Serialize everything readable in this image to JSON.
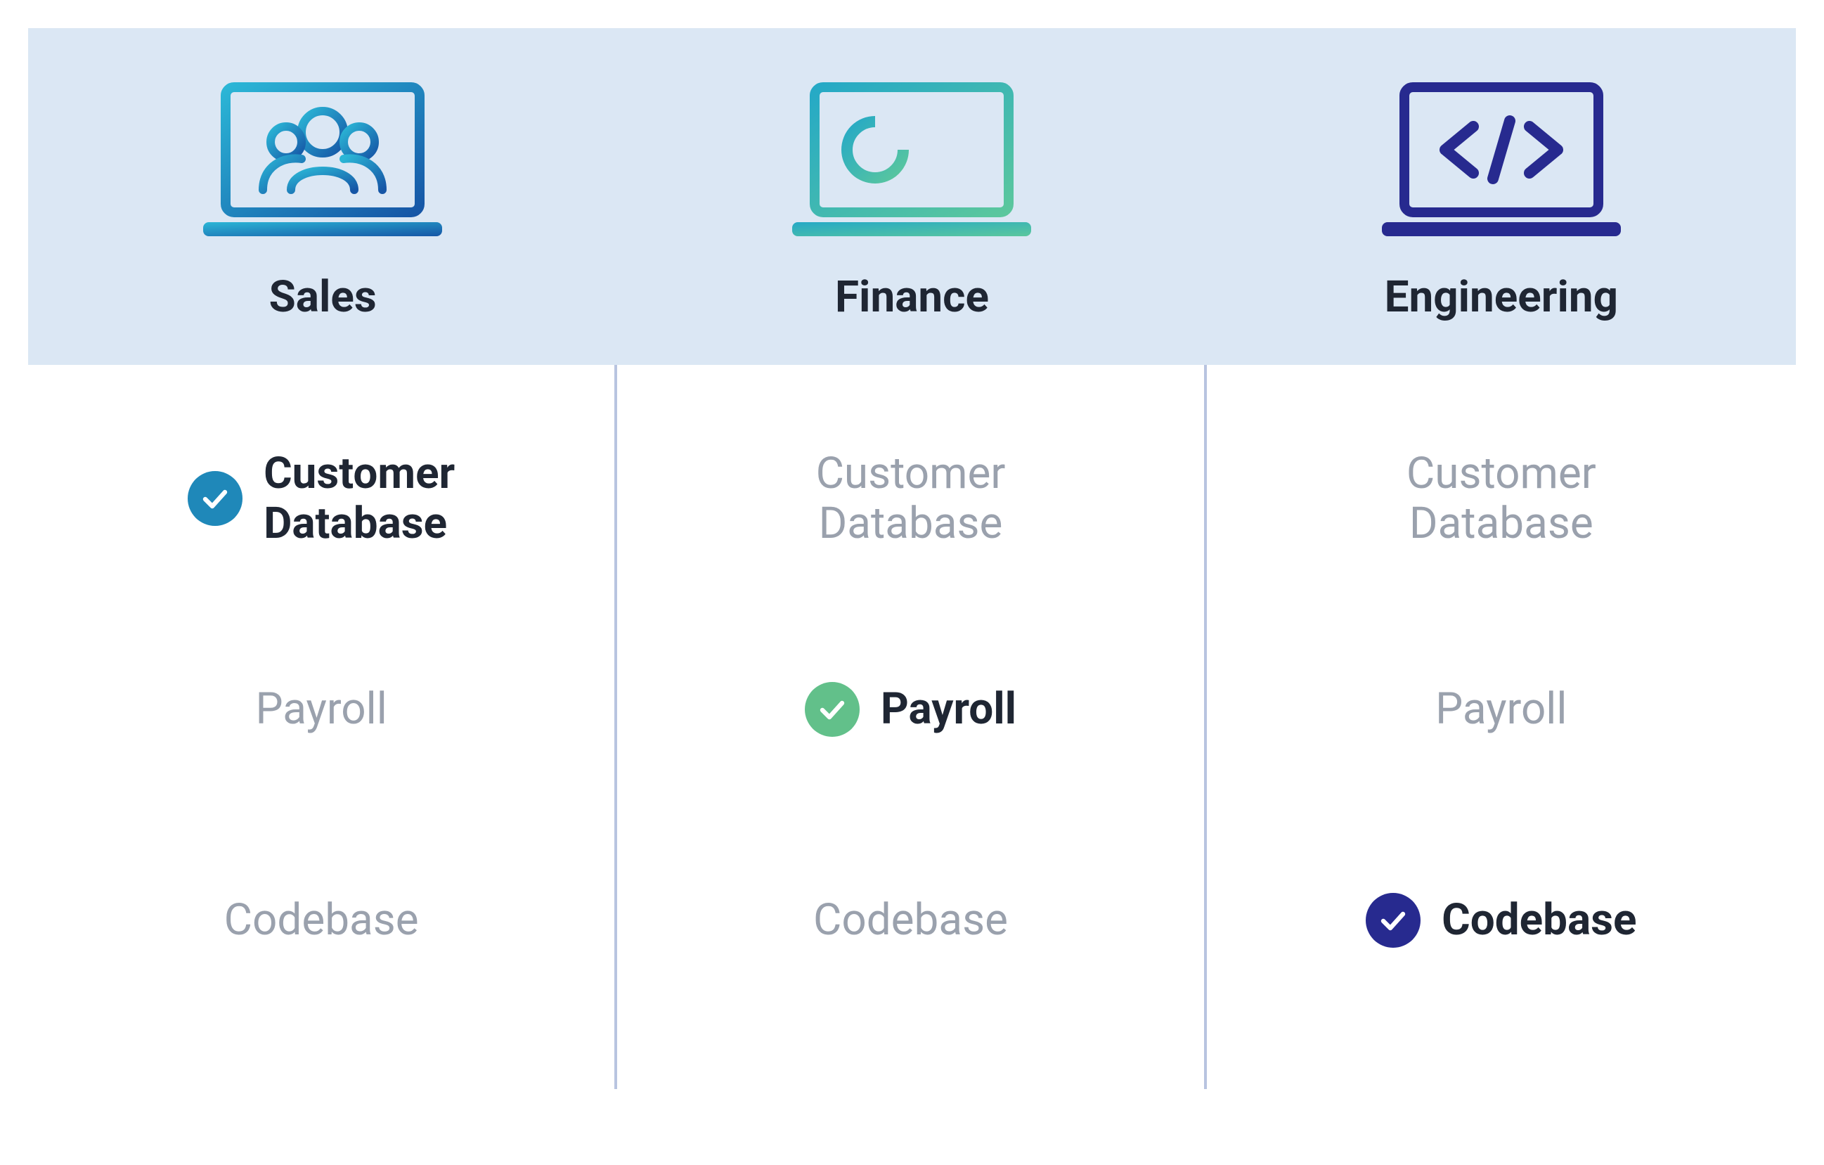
{
  "columns": [
    {
      "title": "Sales",
      "icon": "people-laptop-icon",
      "check_color": "blue",
      "rows": [
        {
          "label": "Customer Database",
          "active": true
        },
        {
          "label": "Payroll",
          "active": false
        },
        {
          "label": "Codebase",
          "active": false
        }
      ]
    },
    {
      "title": "Finance",
      "icon": "chart-laptop-icon",
      "check_color": "green",
      "rows": [
        {
          "label": "Customer Database",
          "active": false
        },
        {
          "label": "Payroll",
          "active": true
        },
        {
          "label": "Codebase",
          "active": false
        }
      ]
    },
    {
      "title": "Engineering",
      "icon": "code-laptop-icon",
      "check_color": "navy",
      "rows": [
        {
          "label": "Customer Database",
          "active": false
        },
        {
          "label": "Payroll",
          "active": false
        },
        {
          "label": "Codebase",
          "active": true
        }
      ]
    }
  ]
}
